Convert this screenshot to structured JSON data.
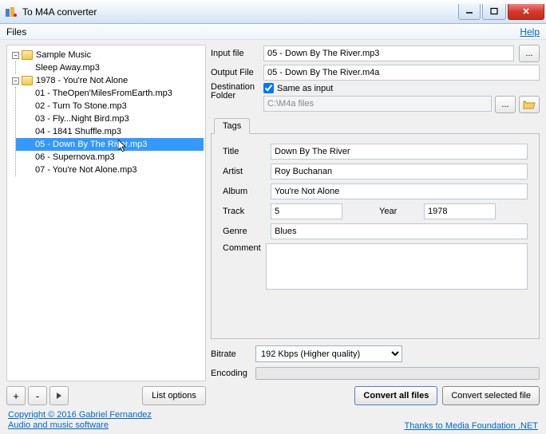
{
  "window": {
    "title": "To M4A converter"
  },
  "menu": {
    "files": "Files",
    "help": "Help"
  },
  "tree": {
    "root1": {
      "label": "Sample Music",
      "items": [
        "Sleep Away.mp3"
      ]
    },
    "root2": {
      "label": "1978 - You're Not Alone",
      "items": [
        "01 - TheOpen'MilesFromEarth.mp3",
        "02 - Turn To Stone.mp3",
        "03 - Fly...Night Bird.mp3",
        "04 - 1841 Shuffle.mp3",
        "05 - Down By The River.mp3",
        "06 - Supernova.mp3",
        "07 - You're Not Alone.mp3"
      ],
      "selectedIndex": 4
    }
  },
  "left": {
    "list_options": "List options"
  },
  "labels": {
    "input_file": "Input file",
    "output_file": "Output File",
    "destination_folder": "Destination Folder",
    "same_as_input": "Same as input",
    "tags": "Tags",
    "title": "Title",
    "artist": "Artist",
    "album": "Album",
    "track": "Track",
    "year": "Year",
    "genre": "Genre",
    "comment": "Comment",
    "bitrate": "Bitrate",
    "encoding": "Encoding",
    "convert_all": "Convert all files",
    "convert_selected": "Convert selected file"
  },
  "values": {
    "input_file": "05 - Down By The River.mp3",
    "output_file": "05 - Down By The River.m4a",
    "dest_path": "C:\\M4a files",
    "title": "Down By The River",
    "artist": "Roy Buchanan",
    "album": "You're Not Alone",
    "track": "5",
    "year": "1978",
    "genre": "Blues",
    "comment": "",
    "bitrate": "192 Kbps (Higher quality)"
  },
  "footer": {
    "copyright": "Copyright ©  2016 Gabriel Fernandez",
    "audio_link": "Audio and music software",
    "thanks": "Thanks to Media Foundation .NET"
  }
}
